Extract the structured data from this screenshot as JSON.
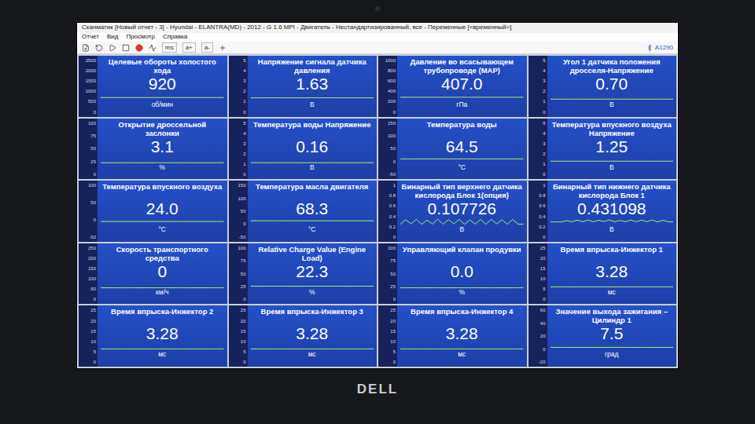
{
  "window": {
    "title": "Сканматик [Новый отчет - 3] - Hyundai - ELANTRA(MD) - 2012 - G 1.6 MPI - Двигатель - Нестандартизированный, все - Переменные [<временный>]"
  },
  "menu": [
    "Отчет",
    "Вид",
    "Просмотр",
    "Справка"
  ],
  "toolbar": {
    "buttons": [
      "ms",
      "a+",
      "a-"
    ],
    "device": "A1290"
  },
  "cells": [
    {
      "title": "Целевые обороты холостого хода",
      "value": "920",
      "unit": "об/мин",
      "ticks": [
        "2500",
        "2000",
        "1500",
        "1000",
        "500",
        "0"
      ],
      "values": [
        920,
        920,
        920,
        920,
        920,
        920,
        920,
        920,
        920,
        920,
        920,
        920
      ]
    },
    {
      "title": "Напряжение сигнала датчика давления",
      "value": "1.63",
      "unit": "В",
      "ticks": [
        "5",
        "4",
        "3",
        "2",
        "1",
        "0"
      ],
      "values": [
        1.63,
        1.62,
        1.64,
        1.63,
        1.63,
        1.62,
        1.63,
        1.64,
        1.63,
        1.63,
        1.62,
        1.63
      ]
    },
    {
      "title": "Давление во всасывающем трубопроводе (MAP)",
      "value": "407.0",
      "unit": "гПа",
      "ticks": [
        "1000",
        "800",
        "600",
        "400",
        "200",
        "0"
      ],
      "values": [
        407,
        405,
        408,
        407,
        406,
        407,
        409,
        407,
        406,
        407,
        408,
        407
      ]
    },
    {
      "title": "Угол 1 датчика положения дросселя-Напряжение",
      "value": "0.70",
      "unit": "В",
      "ticks": [
        "5",
        "4",
        "3",
        "2",
        "1",
        "0"
      ],
      "values": [
        0.7,
        0.7,
        0.7,
        0.7,
        0.7,
        0.7,
        0.7,
        0.7,
        0.7,
        0.7,
        0.7,
        0.7
      ]
    },
    {
      "title": "Открытие дроссельной заслонки",
      "value": "3.1",
      "unit": "%",
      "ticks": [
        "100",
        "75",
        "50",
        "25",
        "0"
      ],
      "values": [
        3.1,
        3.1,
        3.1,
        3.1,
        3.1,
        3.1,
        3.1,
        3.1,
        3.1,
        3.1,
        3.1,
        3.1
      ]
    },
    {
      "title": "Температура воды Напряжение",
      "value": "0.16",
      "unit": "В",
      "ticks": [
        "5",
        "4",
        "3",
        "2",
        "1",
        "0"
      ],
      "values": [
        0.16,
        0.16,
        0.16,
        0.16,
        0.16,
        0.16,
        0.16,
        0.16,
        0.16,
        0.16,
        0.16,
        0.16
      ]
    },
    {
      "title": "Температура воды",
      "value": "64.5",
      "unit": "°C",
      "ticks": [
        "150",
        "100",
        "50",
        "0",
        "-50"
      ],
      "values": [
        63.8,
        63.9,
        64,
        64.1,
        64.1,
        64.2,
        64.3,
        64.3,
        64.4,
        64.4,
        64.5,
        64.5
      ]
    },
    {
      "title": "Температура впускного воздуха Напряжение",
      "value": "1.25",
      "unit": "В",
      "ticks": [
        "5",
        "4",
        "3",
        "2",
        "1",
        "0"
      ],
      "values": [
        1.25,
        1.25,
        1.25,
        1.25,
        1.25,
        1.25,
        1.25,
        1.25,
        1.25,
        1.25,
        1.25,
        1.25
      ]
    },
    {
      "title": "Температура впускного воздуха",
      "value": "24.0",
      "unit": "°C",
      "ticks": [
        "100",
        "50",
        "0",
        "-50"
      ],
      "values": [
        24,
        24,
        24,
        24,
        24,
        24,
        24,
        24,
        24,
        24,
        24,
        24
      ]
    },
    {
      "title": "Температура масла двигателя",
      "value": "68.3",
      "unit": "°C",
      "ticks": [
        "150",
        "100",
        "50",
        "0",
        "-50"
      ],
      "values": [
        67.6,
        67.7,
        67.8,
        67.9,
        67.9,
        68,
        68.1,
        68.1,
        68.2,
        68.2,
        68.3,
        68.3
      ]
    },
    {
      "title": "Бинарный тип верхнего датчика кислорода Блок 1(опция)",
      "value": "0.107726",
      "unit": "В",
      "ticks": [
        "1",
        "0.8",
        "0.6",
        "0.4",
        "0.2",
        "0"
      ],
      "values": [
        0.1,
        0.75,
        0.15,
        0.8,
        0.1,
        0.7,
        0.12,
        0.82,
        0.1,
        0.76,
        0.14,
        0.8,
        0.1,
        0.72,
        0.12,
        0.78,
        0.1,
        0.8,
        0.15,
        0.74,
        0.1,
        0.79,
        0.12,
        0.11
      ]
    },
    {
      "title": "Бинарный тип нижнего датчика кислорода Блок 1",
      "value": "0.431098",
      "unit": "В",
      "ticks": [
        "1",
        "0.8",
        "0.6",
        "0.4",
        "0.2",
        "0"
      ],
      "values": [
        0.43,
        0.43,
        0.43,
        0.6,
        0.45,
        0.68,
        0.47,
        0.7,
        0.45,
        0.66,
        0.48,
        0.72,
        0.44,
        0.65,
        0.46,
        0.7,
        0.45,
        0.68,
        0.47,
        0.71,
        0.44,
        0.66,
        0.46,
        0.43
      ]
    },
    {
      "title": "Скорость транспортного средства",
      "value": "0",
      "unit": "км/ч",
      "ticks": [
        "250",
        "200",
        "150",
        "100",
        "50",
        "0"
      ],
      "values": [
        0,
        0,
        0,
        0,
        0,
        0,
        0,
        0,
        0,
        0,
        0,
        0
      ]
    },
    {
      "title": "Relative Charge Value (Engine Load)",
      "value": "22.3",
      "unit": "%",
      "ticks": [
        "100",
        "75",
        "50",
        "25",
        "0"
      ],
      "values": [
        22.3,
        22.1,
        22.4,
        22.3,
        22.2,
        22.3,
        22.5,
        22.3,
        22.2,
        22.3,
        22.4,
        22.3
      ]
    },
    {
      "title": "Управляющий клапан продувки",
      "value": "0.0",
      "unit": "%",
      "ticks": [
        "100",
        "75",
        "50",
        "25",
        "0"
      ],
      "values": [
        0,
        0,
        0,
        0,
        0,
        0,
        0,
        0,
        0,
        0,
        0,
        0
      ]
    },
    {
      "title": "Время впрыска-Инжектор 1",
      "value": "3.28",
      "unit": "мс",
      "ticks": [
        "25",
        "20",
        "15",
        "10",
        "5",
        "0"
      ],
      "values": [
        3.28,
        3.3,
        3.27,
        3.28,
        3.29,
        3.28,
        3.27,
        3.28,
        3.3,
        3.28,
        3.27,
        3.28
      ]
    },
    {
      "title": "Время впрыска-Инжектор 2",
      "value": "3.28",
      "unit": "мс",
      "ticks": [
        "25",
        "20",
        "15",
        "10",
        "5",
        "0"
      ],
      "values": [
        3.28,
        3.3,
        3.27,
        3.28,
        3.29,
        3.28,
        3.27,
        3.28,
        3.3,
        3.28,
        3.27,
        3.28
      ]
    },
    {
      "title": "Время впрыска-Инжектор 3",
      "value": "3.28",
      "unit": "мс",
      "ticks": [
        "25",
        "20",
        "15",
        "10",
        "5",
        "0"
      ],
      "values": [
        3.28,
        3.3,
        3.27,
        3.28,
        3.29,
        3.28,
        3.27,
        3.28,
        3.3,
        3.28,
        3.27,
        3.28
      ]
    },
    {
      "title": "Время впрыска-Инжектор 4",
      "value": "3.28",
      "unit": "мс",
      "ticks": [
        "25",
        "20",
        "15",
        "10",
        "5",
        "0"
      ],
      "values": [
        3.28,
        3.3,
        3.27,
        3.28,
        3.29,
        3.28,
        3.27,
        3.28,
        3.3,
        3.28,
        3.27,
        3.28
      ]
    },
    {
      "title": "Значение выхода зажигания – Цилиндр 1",
      "value": "7.5",
      "unit": "град",
      "ticks": [
        "60",
        "40",
        "20",
        "0",
        "-20"
      ],
      "values": [
        7.5,
        7.8,
        7.2,
        7.5,
        7.6,
        7.4,
        7.5,
        7.7,
        7.3,
        7.5,
        7.6,
        7.5
      ]
    }
  ],
  "bezel": {
    "logo": "DELL"
  }
}
